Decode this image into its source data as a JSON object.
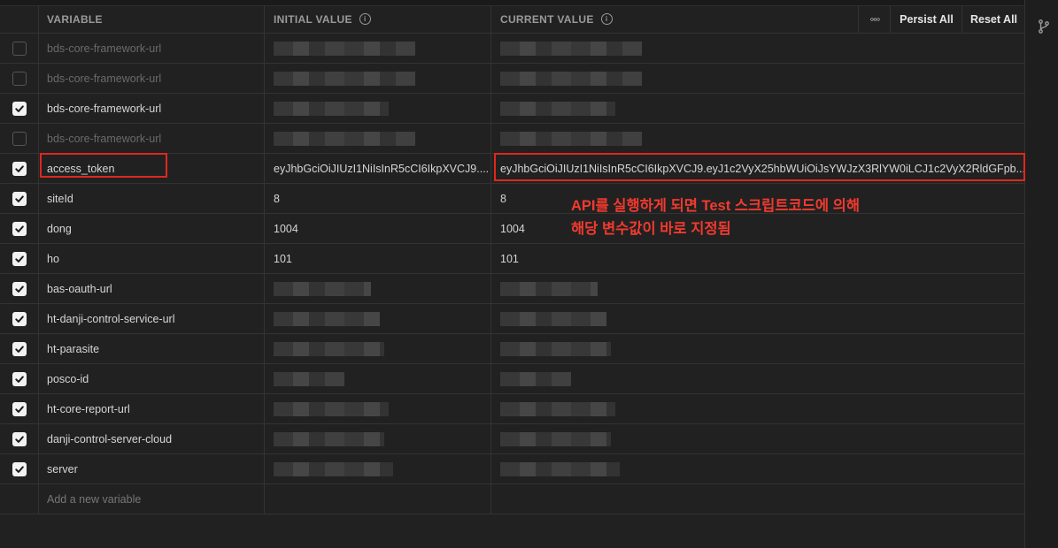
{
  "header": {
    "variable": "VARIABLE",
    "initial_value": "INITIAL VALUE",
    "current_value": "CURRENT VALUE",
    "more": "◦◦◦",
    "persist_all": "Persist All",
    "reset_all": "Reset All"
  },
  "rows": [
    {
      "name": "bds-core-framework-url",
      "checked": false,
      "initial": "",
      "current": ""
    },
    {
      "name": "bds-core-framework-url",
      "checked": false,
      "initial": "",
      "current": ""
    },
    {
      "name": "bds-core-framework-url",
      "checked": true,
      "initial": "",
      "current": ""
    },
    {
      "name": "bds-core-framework-url",
      "checked": false,
      "initial": "",
      "current": ""
    },
    {
      "name": "access_token",
      "checked": true,
      "initial": "eyJhbGciOiJIUzI1NiIsInR5cCI6IkpXVCJ9....",
      "current": "eyJhbGciOiJIUzI1NiIsInR5cCI6IkpXVCJ9.eyJ1c2VyX25hbWUiOiJsYWJzX3RlYW0iLCJ1c2VyX2RldGFpb..."
    },
    {
      "name": "siteId",
      "checked": true,
      "initial": "8",
      "current": "8"
    },
    {
      "name": "dong",
      "checked": true,
      "initial": "1004",
      "current": "1004"
    },
    {
      "name": "ho",
      "checked": true,
      "initial": "101",
      "current": "101"
    },
    {
      "name": "bas-oauth-url",
      "checked": true,
      "initial": "",
      "current": ""
    },
    {
      "name": "ht-danji-control-service-url",
      "checked": true,
      "initial": "",
      "current": ""
    },
    {
      "name": "ht-parasite",
      "checked": true,
      "initial": "",
      "current": ""
    },
    {
      "name": "posco-id",
      "checked": true,
      "initial": "",
      "current": ""
    },
    {
      "name": "ht-core-report-url",
      "checked": true,
      "initial": "",
      "current": ""
    },
    {
      "name": "danji-control-server-cloud",
      "checked": true,
      "initial": "",
      "current": ""
    },
    {
      "name": "server",
      "checked": true,
      "initial": "",
      "current": ""
    }
  ],
  "add_placeholder": "Add a new variable",
  "annotation": {
    "line1": "API를 실행하게 되면 Test 스크립트코드에 의해",
    "line2": "해당 변수값이 바로 지정됨"
  },
  "colors": {
    "background": "#212121",
    "highlight_red": "#e0271e",
    "annotation_red": "#f23a2f"
  },
  "icons": {
    "side_panel": "git-branch-icon",
    "info": "info-icon",
    "checkbox": "check-icon"
  }
}
